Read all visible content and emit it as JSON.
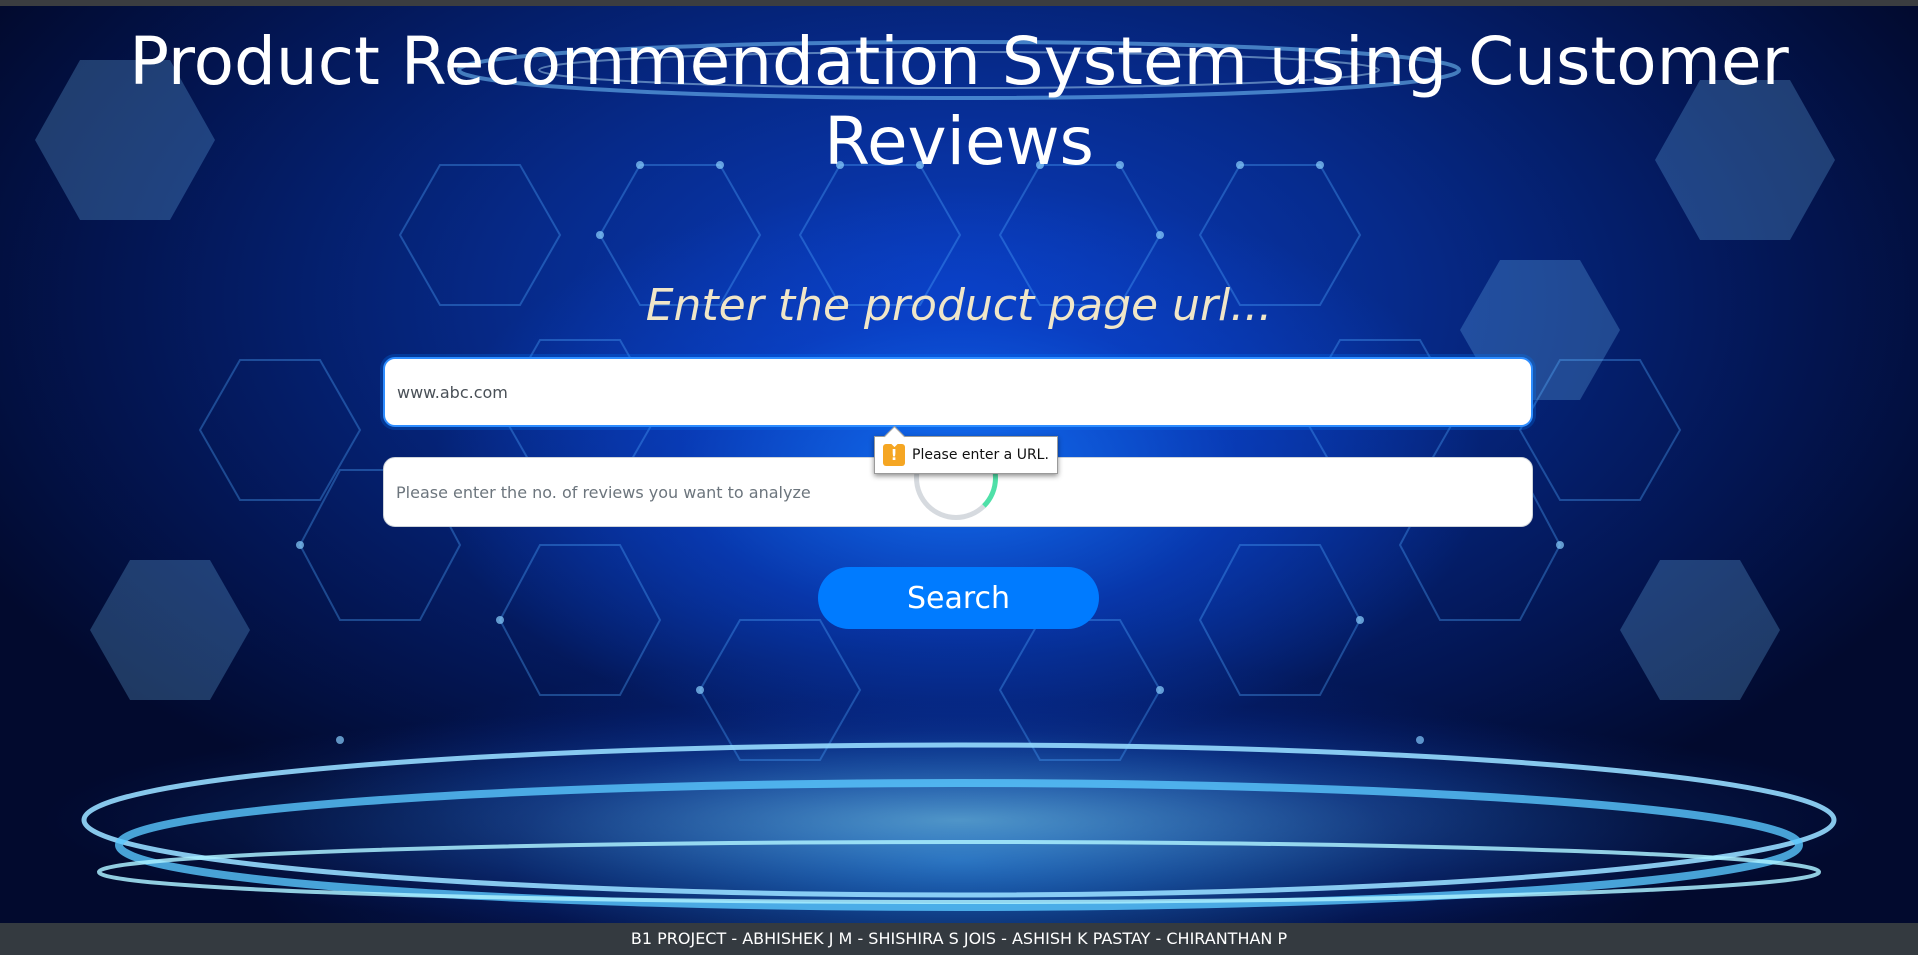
{
  "header": {
    "title": "Product Recommendation System using Customer Reviews"
  },
  "form": {
    "prompt": "Enter the product page url...",
    "url_input": {
      "value": "www.abc.com",
      "placeholder": ""
    },
    "reviews_input": {
      "value": "",
      "placeholder": "Please enter the no. of reviews you want to analyze"
    },
    "search_label": "Search",
    "validation_message": "Please enter a URL.",
    "validation_icon": "warning-icon",
    "validation_icon_glyph": "!"
  },
  "footer": {
    "text": "B1 PROJECT - ABHISHEK J M - SHISHIRA S JOIS - ASHISH K PASTAY - CHIRANTHAN P"
  },
  "colors": {
    "accent": "#007bff",
    "footer_bg": "#343a40",
    "prompt_text": "#f0e6c8",
    "warning": "#f5a623"
  }
}
